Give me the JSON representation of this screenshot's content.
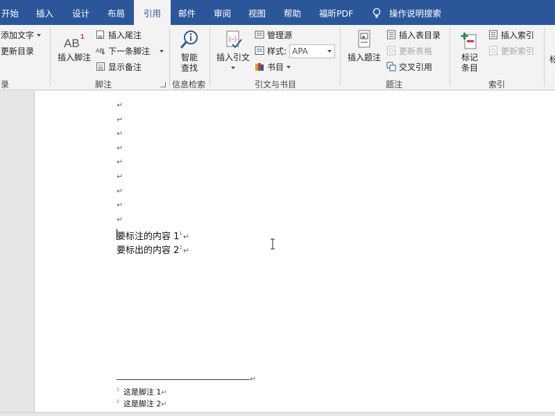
{
  "tabs": [
    {
      "label": "开始"
    },
    {
      "label": "插入"
    },
    {
      "label": "设计"
    },
    {
      "label": "布局"
    },
    {
      "label": "引用",
      "active": true
    },
    {
      "label": "邮件"
    },
    {
      "label": "审阅"
    },
    {
      "label": "视图"
    },
    {
      "label": "帮助"
    },
    {
      "label": "福昕PDF"
    }
  ],
  "tell_me": "操作说明搜索",
  "ribbon": {
    "toc": {
      "add_text": "添加文字",
      "update_toc": "更新目录",
      "group_label": "录"
    },
    "footnotes": {
      "insert_footnote": "插入脚注",
      "insert_endnote": "插入尾注",
      "next_footnote": "下一条脚注",
      "show_notes": "显示备注",
      "group_label": "脚注"
    },
    "research": {
      "smart_lookup_1": "智能",
      "smart_lookup_2": "查找",
      "group_label": "信息检索"
    },
    "citations": {
      "insert_citation": "插入引文",
      "manage_sources": "管理源",
      "style_label": "样式:",
      "style_value": "APA",
      "bibliography": "书目",
      "group_label": "引文与书目"
    },
    "captions": {
      "insert_caption": "插入题注",
      "insert_table_of_figures": "插入表目录",
      "update_table": "更新表格",
      "cross_reference": "交叉引用",
      "group_label": "题注"
    },
    "index": {
      "mark_entry_1": "标记",
      "mark_entry_2": "条目",
      "insert_index": "插入索引",
      "update_index": "更新索引",
      "group_label": "索引"
    },
    "overflow_label": "标"
  },
  "document": {
    "empty_paragraph_marks": [
      "↵",
      "↵",
      "↵",
      "↵",
      "↵",
      "↵",
      "↵",
      "↵",
      "↵"
    ],
    "paragraph_mark": "↵",
    "line1": {
      "text": "要标注的内容 1",
      "ref": "1"
    },
    "line2": {
      "text": "要标出的内容 2",
      "ref": "2"
    },
    "footnotes": [
      {
        "num": "1",
        "text": "这是脚注 1"
      },
      {
        "num": "2",
        "text": "这是脚注 2"
      }
    ]
  },
  "colors": {
    "accent": "#2b579a",
    "ribbon_bg": "#f3f3f3"
  }
}
